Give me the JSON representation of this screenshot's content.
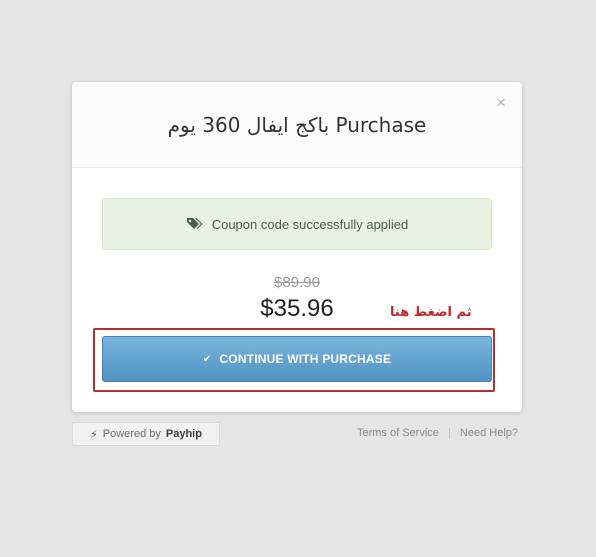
{
  "modal": {
    "title": "باكج ايفال 360 يوم Purchase",
    "close_label": "×",
    "alert": {
      "icon": "tag-icon",
      "text": "Coupon code successfully applied"
    },
    "old_price": "$89.90",
    "new_price": "$35.96",
    "annotation": "ثم اضغط هنا",
    "continue_button": {
      "icon": "check-icon",
      "label": "CONTINUE WITH PURCHASE"
    }
  },
  "footer": {
    "powered_prefix": "Powered by",
    "powered_brand": "Payhip",
    "links": [
      "Terms of Service",
      "Need Help?"
    ]
  },
  "colors": {
    "page_background": "#e5e5e5",
    "button_blue": "#5d9dcc",
    "alert_green": "#e8f1e2",
    "annotation_red": "#c0262b"
  }
}
